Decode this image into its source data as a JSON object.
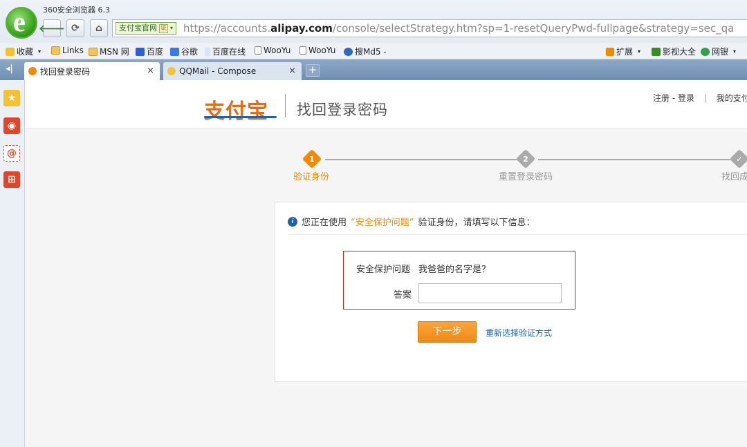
{
  "browser": {
    "app_title": "360安全浏览器 6.3",
    "site_badge": "支付宝官网",
    "cert_label": "证",
    "url_prefix": "https://accounts.",
    "url_domain": "alipay.com",
    "url_path": "/console/selectStrategy.htm?sp=1-resetQueryPwd-fullpage&strategy=sec_qa"
  },
  "bookmarks": {
    "items": [
      "收藏",
      "Links",
      "MSN 网",
      "百度",
      "谷歌",
      "百度在线",
      "WooYu",
      "WooYu",
      "搜Md5 -"
    ],
    "right_items": [
      "扩展",
      "影视大全",
      "网银"
    ]
  },
  "tabs": [
    {
      "label": "找回登录密码",
      "close": "×"
    },
    {
      "label": "QQMail - Compose",
      "close": "×"
    }
  ],
  "new_tab": "+",
  "header": {
    "logo_text": "支付宝",
    "title": "找回登录密码",
    "register": "注册",
    "login": "登录",
    "my_alipay": "我的支付宝"
  },
  "steps": [
    {
      "num": "1",
      "label": "验证身份"
    },
    {
      "num": "2",
      "label": "重置登录密码"
    },
    {
      "num": "✓",
      "label": "找回成功"
    }
  ],
  "notice": {
    "prefix": "您正在使用",
    "highlight": "“安全保护问题”",
    "suffix": "验证身份，请填写以下信息："
  },
  "form": {
    "question_label": "安全保护问题",
    "question_text": "我爸爸的名字是？",
    "answer_label": "答案",
    "answer_value": "",
    "next_button": "下一步",
    "reselect_link": "重新选择验证方式"
  },
  "colors": {
    "accent": "#f08a00",
    "brand_blue": "#1e62b0",
    "highlight_border": "#d81e06"
  }
}
